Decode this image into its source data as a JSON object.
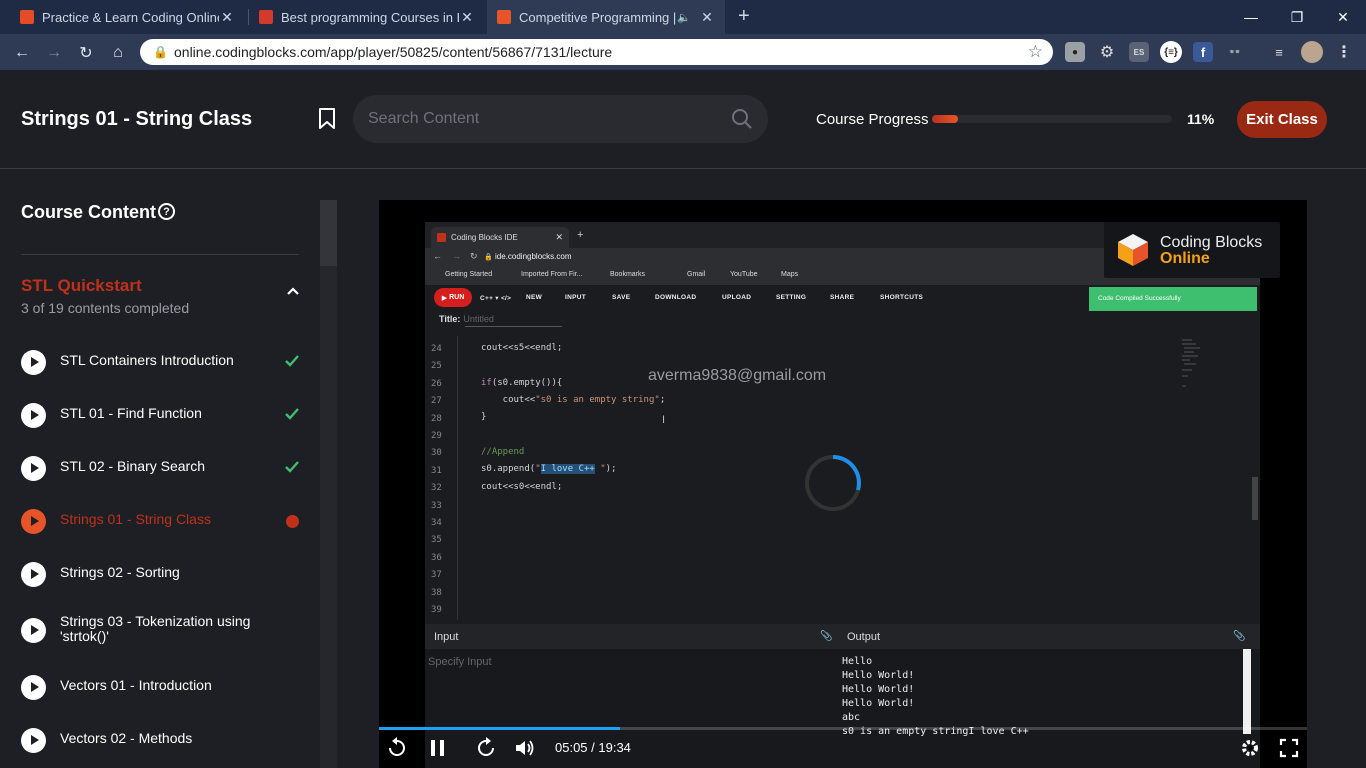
{
  "browser": {
    "tabs": [
      {
        "title": "Practice & Learn Coding Online a",
        "active": false
      },
      {
        "title": "Best programming Courses in De",
        "active": false
      },
      {
        "title": "Competitive Programming | ",
        "active": true
      }
    ],
    "url": "online.codingblocks.com/app/player/50825/content/56867/7131/lecture"
  },
  "header": {
    "lesson_title": "Strings 01 - String Class",
    "search_placeholder": "Search Content",
    "progress_label": "Course Progress",
    "progress_pct": "11%",
    "progress_value": 0.11,
    "exit_label": "Exit Class"
  },
  "sidebar": {
    "title": "Course Content",
    "section": {
      "title": "STL Quickstart",
      "subtitle": "3 of 19 contents completed"
    },
    "items": [
      {
        "label": "STL Containers Introduction",
        "state": "done"
      },
      {
        "label": "STL 01 - Find Function",
        "state": "done"
      },
      {
        "label": "STL 02 - Binary Search",
        "state": "done"
      },
      {
        "label": "Strings 01 - String Class",
        "state": "active"
      },
      {
        "label": "Strings 02 - Sorting",
        "state": "none"
      },
      {
        "label": "Strings 03 - Tokenization using 'strtok()'",
        "state": "none"
      },
      {
        "label": "Vectors 01 - Introduction",
        "state": "none"
      },
      {
        "label": "Vectors 02 - Methods",
        "state": "none"
      }
    ]
  },
  "video": {
    "ide": {
      "tab_title": "Coding Blocks IDE",
      "url": "ide.codingblocks.com",
      "bookmarks": [
        "Getting Started",
        "Imported From Fir...",
        "Bookmarks",
        "Gmail",
        "YouTube",
        "Maps"
      ],
      "run": "RUN",
      "toolbar": [
        "C++ ▾ </>",
        "NEW",
        "INPUT",
        "SAVE",
        "DOWNLOAD",
        "UPLOAD",
        "SETTING",
        "SHARE",
        "SHORTCUTS"
      ],
      "toast": "Code Compiled Successfully",
      "title_label": "Title:",
      "title_value": "Untitled",
      "line_numbers": [
        "24",
        "25",
        "26",
        "27",
        "28",
        "29",
        "30",
        "31",
        "32",
        "33",
        "34",
        "35",
        "36",
        "37",
        "38",
        "39"
      ],
      "input_label": "Input",
      "output_label": "Output",
      "input_placeholder": "Specify Input",
      "output_lines": [
        "Hello",
        "Hello World!",
        "Hello World!",
        "Hello World!",
        "abc",
        "s0 is an empty stringI love C++"
      ]
    },
    "watermark": "averma9838@gmail.com",
    "brand": {
      "line1": "Coding Blocks",
      "line2": "Online"
    },
    "time": "05:05 / 19:34",
    "played_fraction": 0.26
  },
  "colors": {
    "accent": "#c0301b",
    "exit": "#9a2914",
    "check": "#3ebf6f",
    "seek": "#1da1f2"
  }
}
